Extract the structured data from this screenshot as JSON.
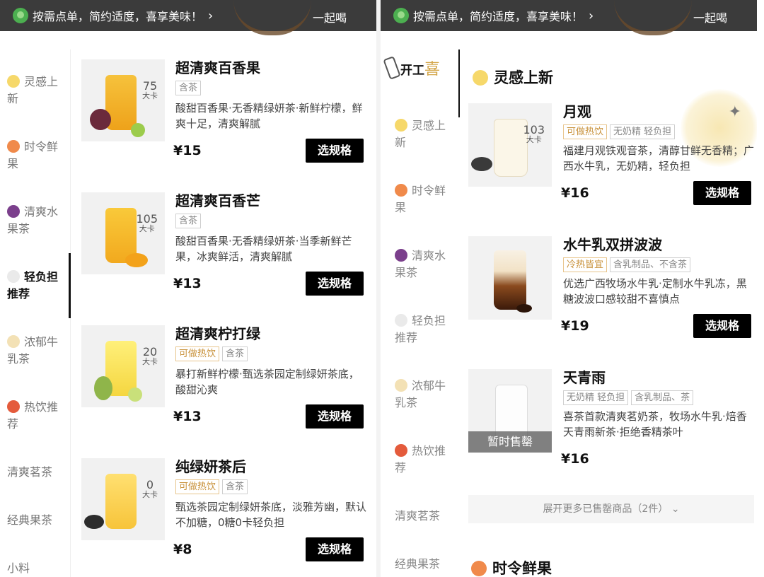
{
  "banner": {
    "text": "按需点单，简约适度，喜享美味！",
    "chevron": "›",
    "action": "一起喝"
  },
  "left_sidebar": [
    {
      "label": "灵感上新",
      "icon": "bulb-icon",
      "active": false
    },
    {
      "label": "时令鲜果",
      "icon": "peach-icon",
      "active": false
    },
    {
      "label": "清爽水果茶",
      "icon": "grape-icon",
      "active": false
    },
    {
      "label": "轻负担推荐",
      "icon": "cloud-icon",
      "active": true
    },
    {
      "label": "浓郁牛乳茶",
      "icon": "milk-bottle-icon",
      "active": false
    },
    {
      "label": "热饮推荐",
      "icon": "hot-steam-icon",
      "active": false
    },
    {
      "label": "清爽茗茶",
      "icon": "",
      "active": false
    },
    {
      "label": "经典果茶",
      "icon": "",
      "active": false
    },
    {
      "label": "小料",
      "icon": "",
      "active": false
    }
  ],
  "left_products": [
    {
      "name": "超清爽百香果",
      "tags": [
        {
          "text": "含茶",
          "warm": false
        }
      ],
      "desc": "酸甜百香果·无香精绿妍茶·新鲜柠檬，鲜爽十足，清爽解腻",
      "price": "¥15",
      "kcal": "75",
      "kcal_unit": "大卡",
      "btn": "选规格"
    },
    {
      "name": "超清爽百香芒",
      "tags": [
        {
          "text": "含茶",
          "warm": false
        }
      ],
      "desc": "酸甜百香果·无香精绿妍茶·当季新鲜芒果，冰爽鲜活，清爽解腻",
      "price": "¥13",
      "kcal": "105",
      "kcal_unit": "大卡",
      "btn": "选规格"
    },
    {
      "name": "超清爽柠打绿",
      "tags": [
        {
          "text": "可做热饮",
          "warm": true
        },
        {
          "text": "含茶",
          "warm": false
        }
      ],
      "desc": "暴打新鲜柠檬·甄选茶园定制绿妍茶底，酸甜沁爽",
      "price": "¥13",
      "kcal": "20",
      "kcal_unit": "大卡",
      "btn": "选规格"
    },
    {
      "name": "纯绿妍茶后",
      "tags": [
        {
          "text": "可做热饮",
          "warm": true
        },
        {
          "text": "含茶",
          "warm": false
        }
      ],
      "desc": "甄选茶园定制绿妍茶底，淡雅芳幽，默认不加糖，0糖0卡轻负担",
      "price": "¥8",
      "kcal": "0",
      "kcal_unit": "大卡",
      "btn": "选规格"
    }
  ],
  "right_logo": {
    "text": "开工",
    "xi": "喜"
  },
  "right_sidebar": [
    {
      "label": "灵感上新",
      "icon": "bulb-icon"
    },
    {
      "label": "时令鲜果",
      "icon": "peach-icon"
    },
    {
      "label": "清爽水果茶",
      "icon": "grape-icon"
    },
    {
      "label": "轻负担推荐",
      "icon": "cloud-icon"
    },
    {
      "label": "浓郁牛乳茶",
      "icon": "milk-bottle-icon"
    },
    {
      "label": "热饮推荐",
      "icon": "hot-steam-icon"
    },
    {
      "label": "清爽茗茶",
      "icon": ""
    },
    {
      "label": "经典果茶",
      "icon": ""
    }
  ],
  "section_1": {
    "title": "灵感上新",
    "icon": "bulb-icon"
  },
  "section_2": {
    "title": "时令鲜果",
    "icon": "peach-icon"
  },
  "right_products": [
    {
      "name": "月观",
      "tags": [
        {
          "text": "可做热饮",
          "warm": true
        },
        {
          "text": "无奶精 轻负担",
          "warm": false
        }
      ],
      "desc": "福建月观铁观音茶，清醇甘鲜无香精；广西水牛乳，无奶精，轻负担",
      "price": "¥16",
      "kcal": "103",
      "kcal_unit": "大卡",
      "btn": "选规格"
    },
    {
      "name": "水牛乳双拼波波",
      "tags": [
        {
          "text": "冷热皆宜",
          "warm": true
        },
        {
          "text": "含乳制品、不含茶",
          "warm": false
        }
      ],
      "desc": "优选广西牧场水牛乳·定制水牛乳冻，黑糖波波口感较甜不喜慎点",
      "price": "¥19",
      "btn": "选规格"
    },
    {
      "name": "天青雨",
      "tags": [
        {
          "text": "无奶精 轻负担",
          "warm": false
        },
        {
          "text": "含乳制品、茶",
          "warm": false
        }
      ],
      "desc": "喜茶首款清爽茗奶茶，牧场水牛乳·焙香天青雨新茶·拒绝香精茶叶",
      "price": "¥16",
      "soldout": "暂时售罄"
    }
  ],
  "expand": {
    "text": "展开更多已售罄商品（2件）",
    "chevron": "⌄"
  },
  "colors": {
    "banner_bg": "#3b3b3b",
    "button_bg": "#000000",
    "warm_tag": "#c8913a",
    "soldout_bg": "#5a5a5a"
  }
}
